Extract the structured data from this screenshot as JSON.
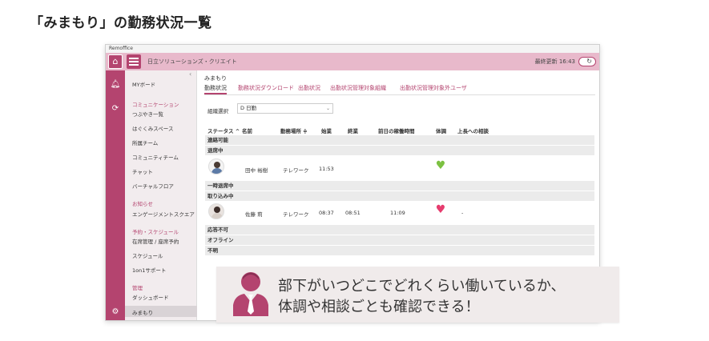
{
  "heading": "「みまもり」の勤務状況一覧",
  "window": {
    "title": "Remoffice",
    "org_name": "日立ソリューションズ・クリエイト",
    "last_update": "最終更新 16:43",
    "refresh_symbol": "↻"
  },
  "sidebar": {
    "items": [
      {
        "label": "MYボード",
        "type": "item"
      },
      {
        "label": "コミュニケーション",
        "type": "group"
      },
      {
        "label": "つぶやき一覧",
        "type": "item"
      },
      {
        "label": "はぐくみスペース",
        "type": "item"
      },
      {
        "label": "所属チーム",
        "type": "item"
      },
      {
        "label": "コミュニティチーム",
        "type": "item"
      },
      {
        "label": "チャット",
        "type": "item"
      },
      {
        "label": "バーチャルフロア",
        "type": "item"
      },
      {
        "label": "お知らせ",
        "type": "group"
      },
      {
        "label": "エンゲージメントスクエア",
        "type": "item"
      },
      {
        "label": "予約・スケジュール",
        "type": "group"
      },
      {
        "label": "在席管理 / 座席予約",
        "type": "item"
      },
      {
        "label": "スケジュール",
        "type": "item"
      },
      {
        "label": "1on1サポート",
        "type": "item"
      },
      {
        "label": "管理",
        "type": "group"
      },
      {
        "label": "ダッシュボード",
        "type": "item"
      },
      {
        "label": "みまもり",
        "type": "item"
      }
    ]
  },
  "main": {
    "breadcrumb": "みまもり",
    "tabs": [
      "勤務状況",
      "勤務状況ダウンロード",
      "出勤状況",
      "出勤状況管理対象組織",
      "出勤状況管理対象外ユーザ"
    ],
    "org_select_label": "組織選択",
    "org_select_value": "D 日勤",
    "columns": [
      "ステータス ^",
      "名前",
      "勤務場所 ≑",
      "始業",
      "終業",
      "前日の稼働時間",
      "体調",
      "上長への相談"
    ],
    "groups": [
      "連絡可能",
      "退席中",
      "一時退席中",
      "取り込み中",
      "応答不可",
      "オフライン",
      "不明"
    ],
    "rows": [
      {
        "name": "田中 裕樹",
        "place": "テレワーク",
        "start": "11:53",
        "end": "",
        "prev_hours": "",
        "health_color": "#7cc142",
        "consult": ""
      },
      {
        "name": "佐藤 莉",
        "place": "テレワーク",
        "start": "08:37",
        "end": "08:51",
        "prev_hours": "11:09",
        "health_color": "#e63c6e",
        "consult": "-"
      }
    ]
  },
  "banner": {
    "line1": "部下がいつどこでどれくらい働いているか、",
    "line2": "体調や相談ごとも確認できる！"
  }
}
